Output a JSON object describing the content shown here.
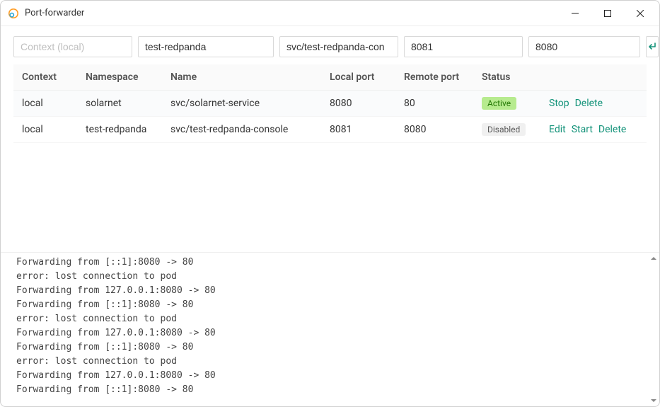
{
  "window": {
    "title": "Port-forwarder"
  },
  "toolbar": {
    "context_placeholder": "Context (local)",
    "context_value": "",
    "namespace_value": "test-redpanda",
    "name_value": "svc/test-redpanda-con",
    "local_port_value": "8081",
    "remote_port_value": "8080"
  },
  "table": {
    "headers": {
      "context": "Context",
      "namespace": "Namespace",
      "name": "Name",
      "local_port": "Local port",
      "remote_port": "Remote port",
      "status": "Status"
    },
    "rows": [
      {
        "context": "local",
        "namespace": "solarnet",
        "name": "svc/solarnet-service",
        "local_port": "8080",
        "remote_port": "80",
        "status_label": "Active",
        "status_kind": "active",
        "actions": [
          {
            "key": "stop",
            "label": "Stop"
          },
          {
            "key": "delete",
            "label": "Delete"
          }
        ]
      },
      {
        "context": "local",
        "namespace": "test-redpanda",
        "name": "svc/test-redpanda-console",
        "local_port": "8081",
        "remote_port": "8080",
        "status_label": "Disabled",
        "status_kind": "disabled",
        "actions": [
          {
            "key": "edit",
            "label": "Edit"
          },
          {
            "key": "start",
            "label": "Start"
          },
          {
            "key": "delete",
            "label": "Delete"
          }
        ]
      }
    ]
  },
  "log": {
    "lines": [
      "Forwarding from [::1]:8080 -> 80",
      "error: lost connection to pod",
      "Forwarding from 127.0.0.1:8080 -> 80",
      "Forwarding from [::1]:8080 -> 80",
      "error: lost connection to pod",
      "Forwarding from 127.0.0.1:8080 -> 80",
      "Forwarding from [::1]:8080 -> 80",
      "error: lost connection to pod",
      "Forwarding from 127.0.0.1:8080 -> 80",
      "Forwarding from [::1]:8080 -> 80"
    ]
  }
}
